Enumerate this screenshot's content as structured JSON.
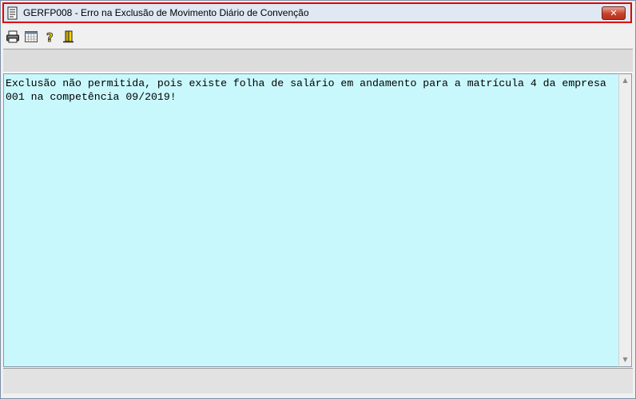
{
  "window": {
    "title": "GERFP008 - Erro na Exclusão de Movimento Diário de Convenção",
    "close_label": "✕"
  },
  "toolbar": {
    "buttons": [
      {
        "name": "print",
        "icon": "printer-icon"
      },
      {
        "name": "calendar",
        "icon": "calendar-icon"
      },
      {
        "name": "help",
        "icon": "question-mark-icon"
      },
      {
        "name": "exit",
        "icon": "exit-door-icon"
      }
    ]
  },
  "message": {
    "text": "Exclusão não permitida, pois existe folha de salário em andamento para a matrícula 4 da empresa 001 na competência 09/2019!"
  },
  "colors": {
    "message_bg": "#c8f8fc",
    "title_border": "#e00000",
    "close_button": "#c7412a"
  }
}
